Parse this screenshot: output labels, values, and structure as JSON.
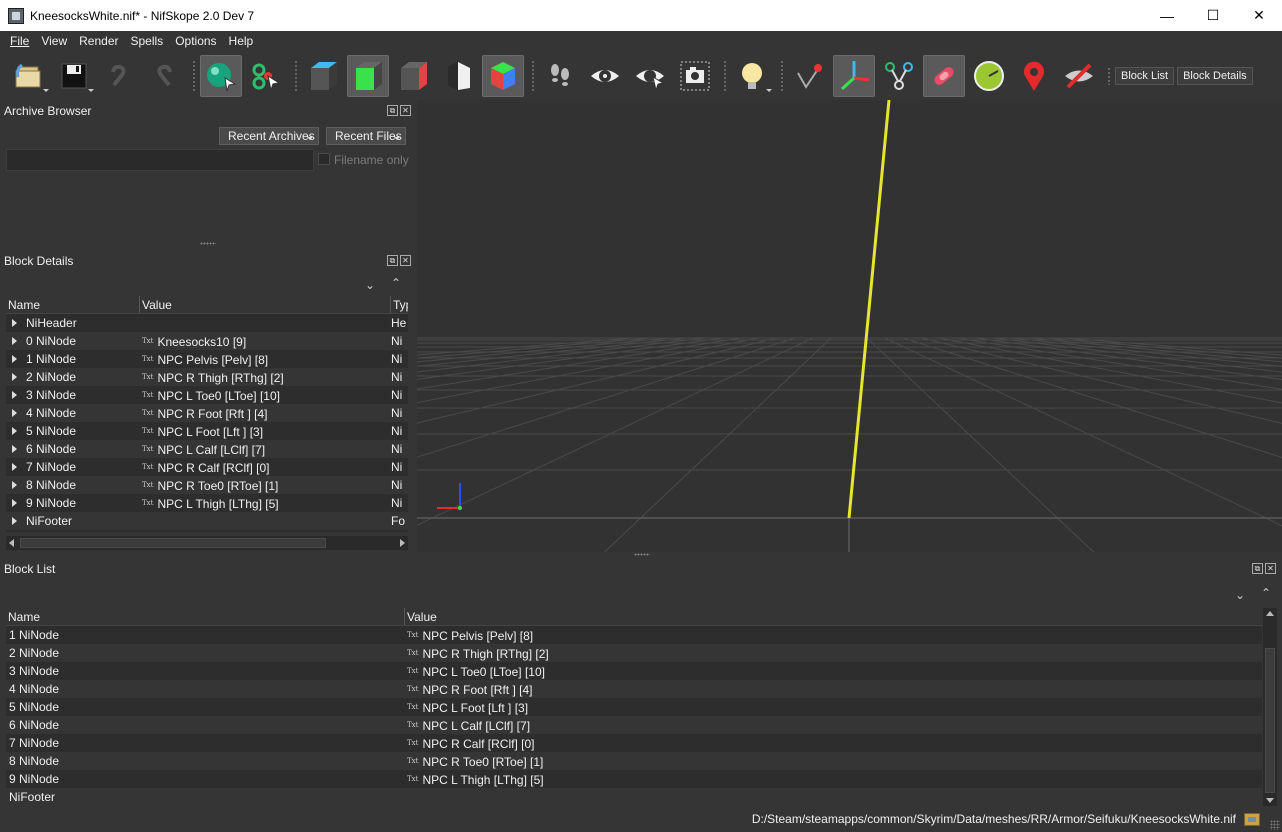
{
  "window": {
    "title": "KneesocksWhite.nif* - NifSkope 2.0 Dev 7",
    "minimize": "—",
    "maximize": "☐",
    "close": "✕"
  },
  "menu": {
    "file": "File",
    "view": "View",
    "render": "Render",
    "spells": "Spells",
    "options": "Options",
    "help": "Help"
  },
  "toolbar": {
    "block_list_label": "Block List",
    "block_details_label": "Block Details"
  },
  "archive_browser": {
    "title": "Archive Browser",
    "recent_archives": "Recent Archives",
    "recent_files": "Recent Files",
    "filename_only": "Filename only"
  },
  "block_details": {
    "title": "Block Details",
    "columns": [
      "Name",
      "Value",
      "Typ"
    ],
    "rows": [
      {
        "name": "NiHeader",
        "value": "",
        "type": "He",
        "txt": false
      },
      {
        "name": "0 NiNode",
        "value": "Kneesocks10 [9]",
        "type": "Ni",
        "txt": true
      },
      {
        "name": "1 NiNode",
        "value": "NPC Pelvis [Pelv] [8]",
        "type": "Ni",
        "txt": true
      },
      {
        "name": "2 NiNode",
        "value": "NPC R Thigh [RThg] [2]",
        "type": "Ni",
        "txt": true
      },
      {
        "name": "3 NiNode",
        "value": "NPC L Toe0 [LToe] [10]",
        "type": "Ni",
        "txt": true
      },
      {
        "name": "4 NiNode",
        "value": "NPC R Foot [Rft ] [4]",
        "type": "Ni",
        "txt": true
      },
      {
        "name": "5 NiNode",
        "value": "NPC L Foot [Lft ] [3]",
        "type": "Ni",
        "txt": true
      },
      {
        "name": "6 NiNode",
        "value": "NPC L Calf [LClf] [7]",
        "type": "Ni",
        "txt": true
      },
      {
        "name": "7 NiNode",
        "value": "NPC R Calf [RClf] [0]",
        "type": "Ni",
        "txt": true
      },
      {
        "name": "8 NiNode",
        "value": "NPC R Toe0 [RToe] [1]",
        "type": "Ni",
        "txt": true
      },
      {
        "name": "9 NiNode",
        "value": "NPC L Thigh [LThg] [5]",
        "type": "Ni",
        "txt": true
      },
      {
        "name": "NiFooter",
        "value": "",
        "type": "Fo",
        "txt": false
      }
    ]
  },
  "block_list": {
    "title": "Block List",
    "columns": [
      "Name",
      "Value"
    ],
    "rows": [
      {
        "name": "1 NiNode",
        "value": "NPC Pelvis [Pelv] [8]",
        "txt": true
      },
      {
        "name": "2 NiNode",
        "value": "NPC R Thigh [RThg] [2]",
        "txt": true
      },
      {
        "name": "3 NiNode",
        "value": "NPC L Toe0 [LToe] [10]",
        "txt": true
      },
      {
        "name": "4 NiNode",
        "value": "NPC R Foot [Rft ] [4]",
        "txt": true
      },
      {
        "name": "5 NiNode",
        "value": "NPC L Foot [Lft ] [3]",
        "txt": true
      },
      {
        "name": "6 NiNode",
        "value": "NPC L Calf [LClf] [7]",
        "txt": true
      },
      {
        "name": "7 NiNode",
        "value": "NPC R Calf [RClf] [0]",
        "txt": true
      },
      {
        "name": "8 NiNode",
        "value": "NPC R Toe0 [RToe] [1]",
        "txt": true
      },
      {
        "name": "9 NiNode",
        "value": "NPC L Thigh [LThg] [5]",
        "txt": true
      },
      {
        "name": "NiFooter",
        "value": "",
        "txt": false
      }
    ]
  },
  "status": {
    "path": "D:/Steam/steamapps/common/Skyrim/Data/meshes/RR/Armor/Seifuku/KneesocksWhite.nif"
  },
  "txt_icon": "Txt",
  "colors": {
    "background": "#353535",
    "viewport": "#323232",
    "grid_line": "#555555",
    "axis_yellow": "#e6e62e"
  }
}
